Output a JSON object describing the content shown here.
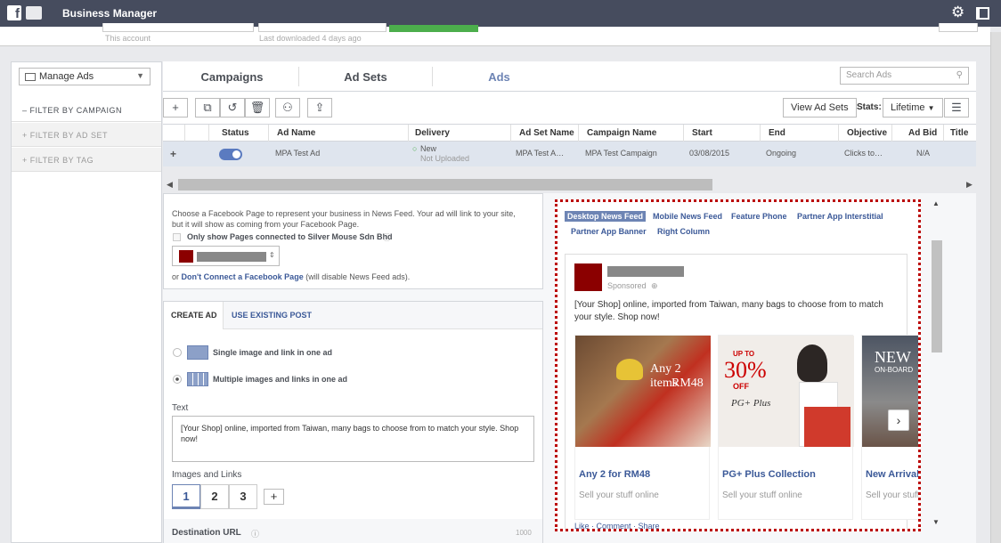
{
  "header": {
    "title": "Business Manager"
  },
  "subbar": {
    "account_hint": "This account",
    "download_hint": "Last downloaded 4 days ago"
  },
  "left": {
    "manage_label": "Manage Ads",
    "filters": [
      "FILTER BY CAMPAIGN",
      "FILTER BY AD SET",
      "FILTER BY TAG"
    ]
  },
  "tabs": [
    "Campaigns",
    "Ad Sets",
    "Ads"
  ],
  "search": {
    "placeholder": "Search Ads"
  },
  "toolbar": {
    "view_ad_sets": "View Ad Sets",
    "stats_label": "Stats:",
    "stats_value": "Lifetime"
  },
  "table": {
    "columns": [
      "Status",
      "Ad Name",
      "Delivery",
      "Ad Set Name",
      "Campaign Name",
      "Start",
      "End",
      "Objective",
      "Ad Bid",
      "Title"
    ],
    "row": {
      "ad_name": "MPA Test Ad",
      "delivery": "New",
      "delivery_sub": "Not Uploaded",
      "ad_set_name": "MPA Test A…",
      "campaign_name": "MPA Test Campaign",
      "start": "03/08/2015",
      "end": "Ongoing",
      "objective": "Clicks to…",
      "ad_bid": "N/A"
    }
  },
  "page_panel": {
    "description": "Choose a Facebook Page to represent your business in News Feed. Your ad will link to your site, but it will show as coming from your Facebook Page.",
    "only_pages": "Only show Pages connected to Silver Mouse Sdn Bhd",
    "or": "or",
    "dont_connect": "Don't Connect a Facebook Page",
    "dont_connect_note": "(will disable News Feed ads)."
  },
  "create_panel": {
    "tab_create": "CREATE AD",
    "tab_existing": "USE EXISTING POST",
    "single": "Single image and link in one ad",
    "multiple": "Multiple images and links in one ad",
    "text_label": "Text",
    "text_value": "[Your Shop] online, imported from Taiwan, many bags to choose from to match your style. Shop now!",
    "images_label": "Images and Links",
    "pages": [
      "1",
      "2",
      "3"
    ],
    "add": "+",
    "destination": "Destination URL",
    "counter": "1000"
  },
  "preview": {
    "tabs": [
      "Desktop News Feed",
      "Mobile News Feed",
      "Feature Phone",
      "Partner App Interstitial",
      "Partner App Banner",
      "Right Column"
    ],
    "sponsored": "Sponsored",
    "body": "[Your Shop] online, imported from Taiwan, many bags to choose from to match your style. Shop now!",
    "cards": [
      {
        "title": "Any 2 for RM48",
        "sub": "Sell your stuff online",
        "overlay1": "Any 2 items",
        "overlay2": "RM48"
      },
      {
        "title": "PG+ Plus Collection",
        "sub": "Sell your stuff online",
        "overlay1": "UP TO",
        "overlay2": "30%",
        "overlay3": "OFF",
        "overlay4": "PG+ Plus"
      },
      {
        "title": "New Arrivals",
        "sub": "Sell your stuff online",
        "overlay1": "NEW",
        "overlay2": "ON-BOARD"
      }
    ],
    "actions": "Like · Comment · Share"
  },
  "colors": {
    "accent": "#6d84b4",
    "topbar": "#464c5e",
    "link": "#3b5998",
    "highlight_border": "#bb0000"
  }
}
